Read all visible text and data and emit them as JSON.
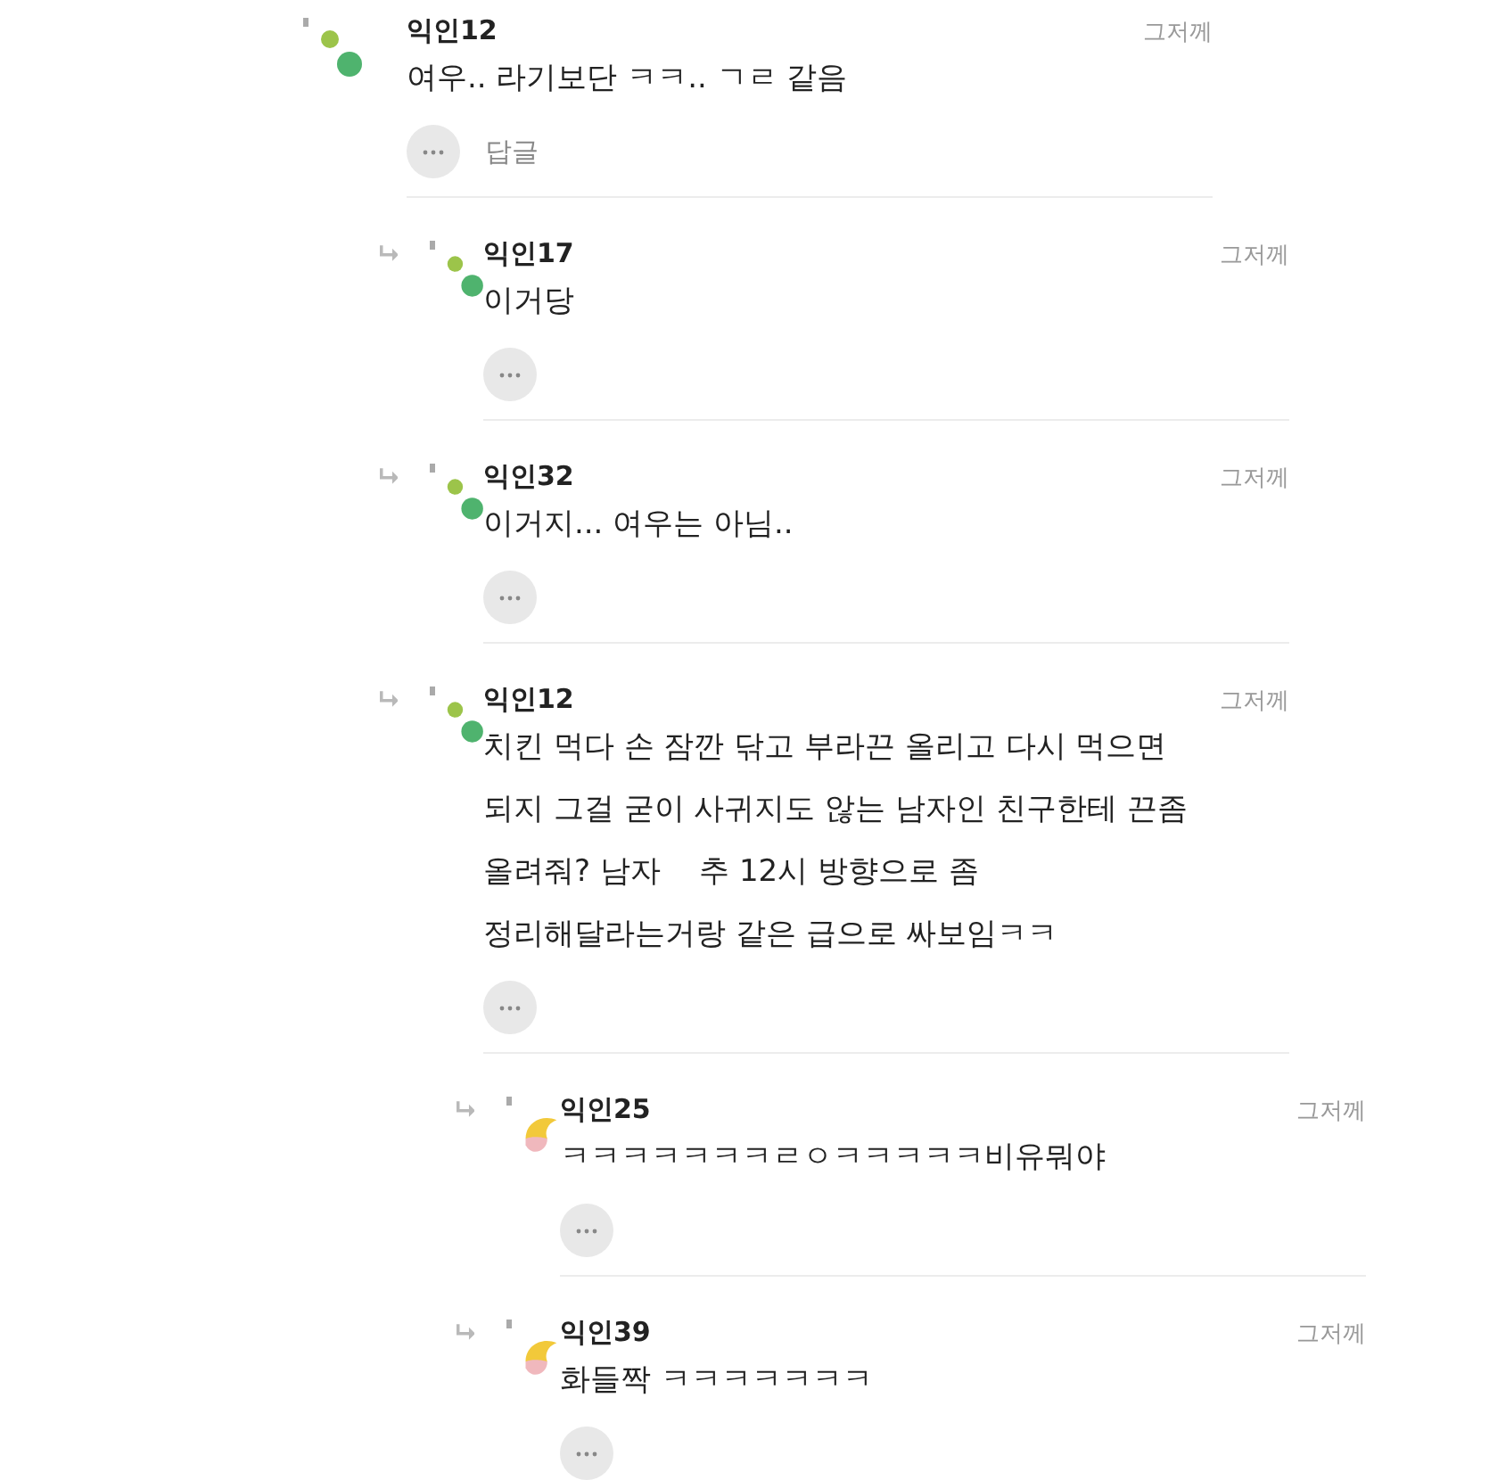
{
  "comments": [
    {
      "author": "익인12",
      "time": "그저께",
      "text": "여우.. 라기보단 ㅋㅋ.. ㄱㄹ 같음",
      "reply_label": "답글",
      "avatar": {
        "kind": "dots"
      },
      "children": [
        {
          "author": "익인17",
          "time": "그저께",
          "text": "이거당",
          "avatar": {
            "kind": "dots"
          }
        },
        {
          "author": "익인32",
          "time": "그저께",
          "text": "이거지... 여우는 아님..",
          "avatar": {
            "kind": "dots"
          }
        },
        {
          "author": "익인12",
          "time": "그저께",
          "text": "치킨 먹다 손 잠깐 닦고 부라끈 올리고 다시 먹으면 되지 그걸 굳이 사귀지도 않는 남자인 친구한테 끈좀 올려줘? 남자    추 12시 방향으로 좀 정리해달라는거랑 같은 급으로 싸보임ㅋㅋ",
          "avatar": {
            "kind": "dots"
          },
          "children": [
            {
              "author": "익인25",
              "time": "그저께",
              "text": "ㅋㅋㅋㅋㅋㅋㅋㄹㅇㅋㅋㅋㅋㅋ비유뭐야",
              "avatar": {
                "kind": "swirl"
              }
            },
            {
              "author": "익인39",
              "time": "그저께",
              "text": "화들짝 ㅋㅋㅋㅋㅋㅋㅋ",
              "avatar": {
                "kind": "swirl"
              }
            }
          ]
        }
      ]
    }
  ]
}
